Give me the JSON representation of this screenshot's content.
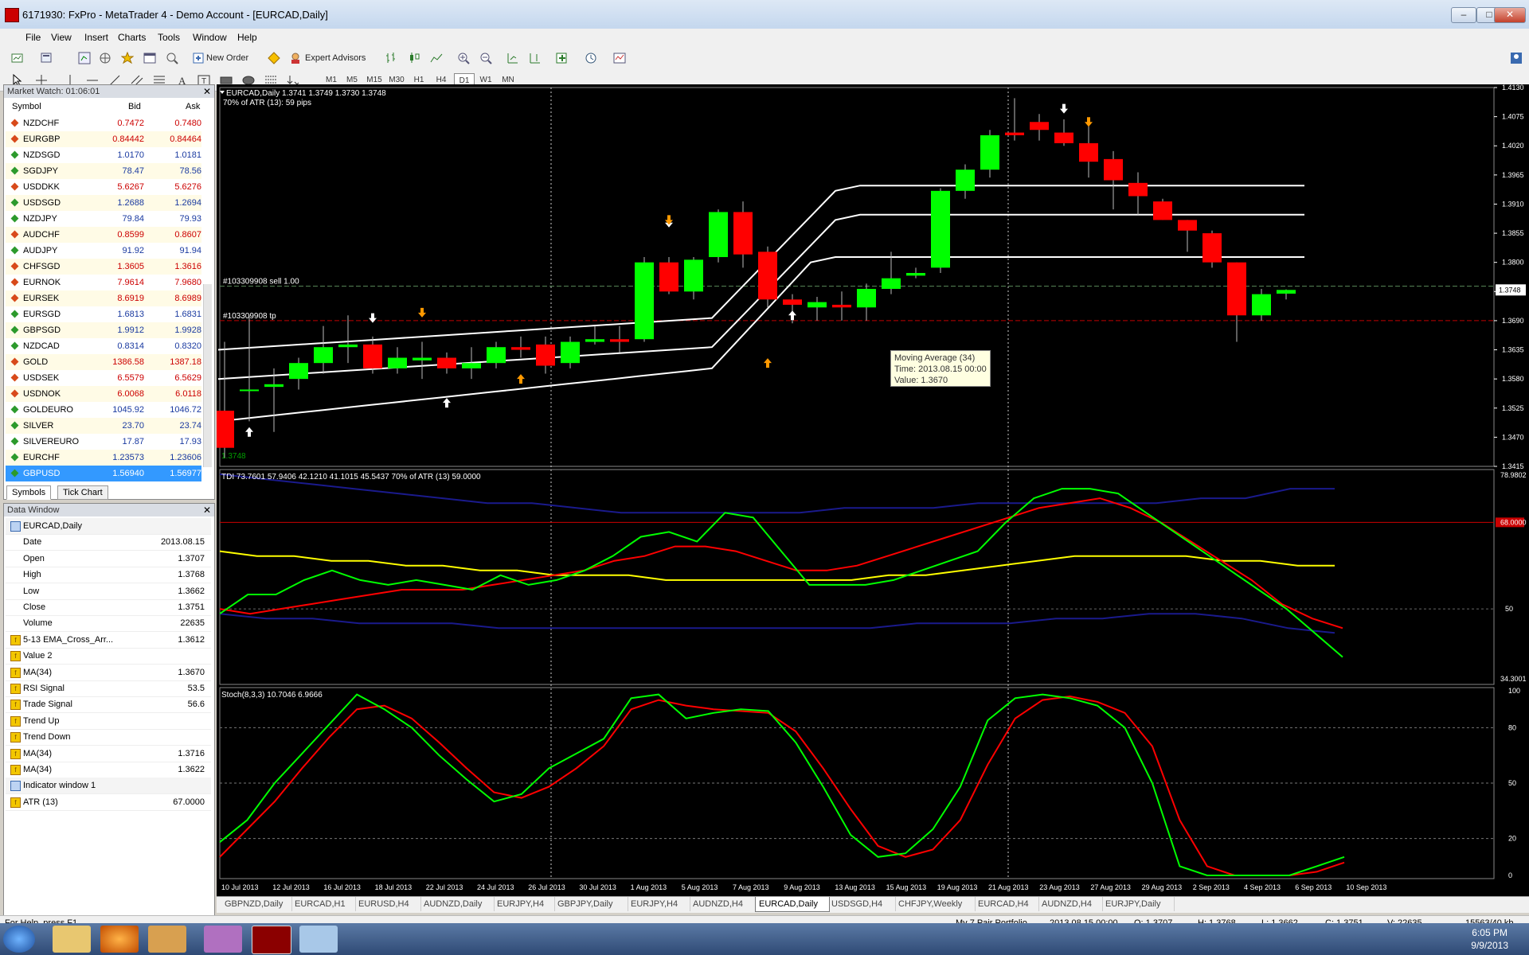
{
  "window": {
    "title": "6171930: FxPro - MetaTrader 4 - Demo Account - [EURCAD,Daily]",
    "minimize": "–",
    "restore": "□",
    "close": "✕"
  },
  "menu": [
    "File",
    "View",
    "Insert",
    "Charts",
    "Tools",
    "Window",
    "Help"
  ],
  "toolbar": {
    "new_order": "New Order",
    "expert_advisors": "Expert Advisors",
    "timeframes": [
      "M1",
      "M5",
      "M15",
      "M30",
      "H1",
      "H4",
      "D1",
      "W1",
      "MN"
    ],
    "active_timeframe": "D1"
  },
  "market_watch": {
    "title": "Market Watch: 01:06:01",
    "headers": {
      "symbol": "Symbol",
      "bid": "Bid",
      "ask": "Ask"
    },
    "rows": [
      {
        "symbol": "NZDCHF",
        "bid": "0.7472",
        "ask": "0.7480",
        "dir": "down"
      },
      {
        "symbol": "EURGBP",
        "bid": "0.84442",
        "ask": "0.84464",
        "dir": "down"
      },
      {
        "symbol": "NZDSGD",
        "bid": "1.0170",
        "ask": "1.0181",
        "dir": "up"
      },
      {
        "symbol": "SGDJPY",
        "bid": "78.47",
        "ask": "78.56",
        "dir": "up"
      },
      {
        "symbol": "USDDKK",
        "bid": "5.6267",
        "ask": "5.6276",
        "dir": "down"
      },
      {
        "symbol": "USDSGD",
        "bid": "1.2688",
        "ask": "1.2694",
        "dir": "up"
      },
      {
        "symbol": "NZDJPY",
        "bid": "79.84",
        "ask": "79.93",
        "dir": "up"
      },
      {
        "symbol": "AUDCHF",
        "bid": "0.8599",
        "ask": "0.8607",
        "dir": "down"
      },
      {
        "symbol": "AUDJPY",
        "bid": "91.92",
        "ask": "91.94",
        "dir": "up"
      },
      {
        "symbol": "CHFSGD",
        "bid": "1.3605",
        "ask": "1.3616",
        "dir": "down"
      },
      {
        "symbol": "EURNOK",
        "bid": "7.9614",
        "ask": "7.9680",
        "dir": "down"
      },
      {
        "symbol": "EURSEK",
        "bid": "8.6919",
        "ask": "8.6989",
        "dir": "down"
      },
      {
        "symbol": "EURSGD",
        "bid": "1.6813",
        "ask": "1.6831",
        "dir": "up"
      },
      {
        "symbol": "GBPSGD",
        "bid": "1.9912",
        "ask": "1.9928",
        "dir": "up"
      },
      {
        "symbol": "NZDCAD",
        "bid": "0.8314",
        "ask": "0.8320",
        "dir": "up"
      },
      {
        "symbol": "GOLD",
        "bid": "1386.58",
        "ask": "1387.18",
        "dir": "down"
      },
      {
        "symbol": "USDSEK",
        "bid": "6.5579",
        "ask": "6.5629",
        "dir": "down"
      },
      {
        "symbol": "USDNOK",
        "bid": "6.0068",
        "ask": "6.0118",
        "dir": "down"
      },
      {
        "symbol": "GOLDEURO",
        "bid": "1045.92",
        "ask": "1046.72",
        "dir": "up"
      },
      {
        "symbol": "SILVER",
        "bid": "23.70",
        "ask": "23.74",
        "dir": "up"
      },
      {
        "symbol": "SILVEREURO",
        "bid": "17.87",
        "ask": "17.93",
        "dir": "up"
      },
      {
        "symbol": "EURCHF",
        "bid": "1.23573",
        "ask": "1.23606",
        "dir": "up"
      },
      {
        "symbol": "GBPUSD",
        "bid": "1.56940",
        "ask": "1.56977",
        "dir": "up"
      }
    ],
    "tabs": [
      "Symbols",
      "Tick Chart"
    ]
  },
  "data_window": {
    "title": "Data Window",
    "rows": [
      {
        "label": "EURCAD,Daily",
        "value": "",
        "kind": "header"
      },
      {
        "label": "Date",
        "value": "2013.08.15",
        "kind": "plain"
      },
      {
        "label": "Open",
        "value": "1.3707",
        "kind": "plain"
      },
      {
        "label": "High",
        "value": "1.3768",
        "kind": "plain"
      },
      {
        "label": "Low",
        "value": "1.3662",
        "kind": "plain"
      },
      {
        "label": "Close",
        "value": "1.3751",
        "kind": "plain"
      },
      {
        "label": "Volume",
        "value": "22635",
        "kind": "plain"
      },
      {
        "label": "5-13 EMA_Cross_Arr...",
        "value": "1.3612",
        "kind": "ind"
      },
      {
        "label": "Value 2",
        "value": "",
        "kind": "ind"
      },
      {
        "label": "MA(34)",
        "value": "1.3670",
        "kind": "ind"
      },
      {
        "label": "RSI Signal",
        "value": "53.5",
        "kind": "ind"
      },
      {
        "label": "Trade Signal",
        "value": "56.6",
        "kind": "ind"
      },
      {
        "label": "Trend Up",
        "value": "",
        "kind": "ind"
      },
      {
        "label": "Trend Down",
        "value": "",
        "kind": "ind"
      },
      {
        "label": "MA(34)",
        "value": "1.3716",
        "kind": "ind"
      },
      {
        "label": "MA(34)",
        "value": "1.3622",
        "kind": "ind"
      },
      {
        "label": "Indicator window 1",
        "value": "",
        "kind": "header"
      },
      {
        "label": "ATR (13)",
        "value": "67.0000",
        "kind": "ind"
      }
    ]
  },
  "chart": {
    "header": "EURCAD,Daily  1.3741 1.3749 1.3730 1.3748",
    "atr_note": "70% of ATR (13): 59 pips",
    "sell_label": "#103309908 sell 1.00",
    "tp_label": "#103309908 tp",
    "big_price": "1.3748",
    "current_price": "1.3748",
    "price_axis": [
      "1.4130",
      "1.4075",
      "1.4020",
      "1.3965",
      "1.3910",
      "1.3855",
      "1.3800",
      "1.3745",
      "1.3690",
      "1.3635",
      "1.3580",
      "1.3525",
      "1.3470",
      "1.3415"
    ],
    "tdi_header": "TDI 73.7601 57.9406 42.1210 41.1015 45.5437  70% of ATR (13) 59.0000",
    "tdi_axis": {
      "top": "78.9802",
      "level": "68.0000",
      "mid": "50",
      "bottom": "34.3001"
    },
    "stoch_header": "Stoch(8,3,3) 10.7046 6.9666",
    "stoch_axis": [
      "100",
      "80",
      "50",
      "20",
      "0"
    ],
    "date_axis": [
      "10 Jul 2013",
      "12 Jul 2013",
      "16 Jul 2013",
      "18 Jul 2013",
      "22 Jul 2013",
      "24 Jul 2013",
      "26 Jul 2013",
      "30 Jul 2013",
      "1 Aug 2013",
      "5 Aug 2013",
      "7 Aug 2013",
      "9 Aug 2013",
      "13 Aug 2013",
      "15 Aug 2013",
      "19 Aug 2013",
      "21 Aug 2013",
      "23 Aug 2013",
      "27 Aug 2013",
      "29 Aug 2013",
      "2 Sep 2013",
      "4 Sep 2013",
      "6 Sep 2013",
      "10 Sep 2013"
    ]
  },
  "chart_data": {
    "type": "candlestick",
    "symbol": "EURCAD",
    "timeframe": "Daily",
    "ylim": [
      1.3415,
      1.413
    ],
    "candles": [
      {
        "o": 1.352,
        "h": 1.365,
        "l": 1.343,
        "c": 1.345
      },
      {
        "o": 1.356,
        "h": 1.37,
        "l": 1.35,
        "c": 1.356
      },
      {
        "o": 1.3565,
        "h": 1.36,
        "l": 1.348,
        "c": 1.357
      },
      {
        "o": 1.358,
        "h": 1.362,
        "l": 1.356,
        "c": 1.361
      },
      {
        "o": 1.361,
        "h": 1.368,
        "l": 1.359,
        "c": 1.364
      },
      {
        "o": 1.364,
        "h": 1.37,
        "l": 1.361,
        "c": 1.3645
      },
      {
        "o": 1.3645,
        "h": 1.366,
        "l": 1.359,
        "c": 1.36
      },
      {
        "o": 1.36,
        "h": 1.364,
        "l": 1.359,
        "c": 1.362
      },
      {
        "o": 1.3615,
        "h": 1.365,
        "l": 1.358,
        "c": 1.362
      },
      {
        "o": 1.362,
        "h": 1.363,
        "l": 1.359,
        "c": 1.36
      },
      {
        "o": 1.36,
        "h": 1.364,
        "l": 1.358,
        "c": 1.361
      },
      {
        "o": 1.361,
        "h": 1.365,
        "l": 1.36,
        "c": 1.364
      },
      {
        "o": 1.364,
        "h": 1.366,
        "l": 1.362,
        "c": 1.3635
      },
      {
        "o": 1.3645,
        "h": 1.366,
        "l": 1.359,
        "c": 1.3605
      },
      {
        "o": 1.361,
        "h": 1.366,
        "l": 1.36,
        "c": 1.365
      },
      {
        "o": 1.365,
        "h": 1.368,
        "l": 1.3645,
        "c": 1.3655
      },
      {
        "o": 1.3655,
        "h": 1.368,
        "l": 1.363,
        "c": 1.365
      },
      {
        "o": 1.3655,
        "h": 1.381,
        "l": 1.365,
        "c": 1.38
      },
      {
        "o": 1.38,
        "h": 1.381,
        "l": 1.374,
        "c": 1.3745
      },
      {
        "o": 1.3745,
        "h": 1.381,
        "l": 1.373,
        "c": 1.3805
      },
      {
        "o": 1.381,
        "h": 1.39,
        "l": 1.38,
        "c": 1.3895
      },
      {
        "o": 1.3895,
        "h": 1.3915,
        "l": 1.379,
        "c": 1.3815
      },
      {
        "o": 1.382,
        "h": 1.383,
        "l": 1.3715,
        "c": 1.373
      },
      {
        "o": 1.373,
        "h": 1.374,
        "l": 1.3685,
        "c": 1.372
      },
      {
        "o": 1.3715,
        "h": 1.3735,
        "l": 1.369,
        "c": 1.3725
      },
      {
        "o": 1.372,
        "h": 1.3745,
        "l": 1.369,
        "c": 1.3715
      },
      {
        "o": 1.3715,
        "h": 1.376,
        "l": 1.369,
        "c": 1.375
      },
      {
        "o": 1.375,
        "h": 1.382,
        "l": 1.374,
        "c": 1.377
      },
      {
        "o": 1.3775,
        "h": 1.379,
        "l": 1.377,
        "c": 1.378
      },
      {
        "o": 1.379,
        "h": 1.394,
        "l": 1.378,
        "c": 1.3935
      },
      {
        "o": 1.3935,
        "h": 1.3985,
        "l": 1.392,
        "c": 1.3975
      },
      {
        "o": 1.3975,
        "h": 1.405,
        "l": 1.396,
        "c": 1.404
      },
      {
        "o": 1.4045,
        "h": 1.411,
        "l": 1.403,
        "c": 1.404
      },
      {
        "o": 1.4065,
        "h": 1.408,
        "l": 1.403,
        "c": 1.405
      },
      {
        "o": 1.4045,
        "h": 1.407,
        "l": 1.402,
        "c": 1.4025
      },
      {
        "o": 1.4025,
        "h": 1.406,
        "l": 1.396,
        "c": 1.399
      },
      {
        "o": 1.3995,
        "h": 1.401,
        "l": 1.39,
        "c": 1.3955
      },
      {
        "o": 1.395,
        "h": 1.397,
        "l": 1.389,
        "c": 1.3925
      },
      {
        "o": 1.3915,
        "h": 1.392,
        "l": 1.388,
        "c": 1.388
      },
      {
        "o": 1.388,
        "h": 1.388,
        "l": 1.382,
        "c": 1.386
      },
      {
        "o": 1.3855,
        "h": 1.386,
        "l": 1.379,
        "c": 1.38
      },
      {
        "o": 1.38,
        "h": 1.38,
        "l": 1.365,
        "c": 1.37
      },
      {
        "o": 1.37,
        "h": 1.375,
        "l": 1.369,
        "c": 1.374
      },
      {
        "o": 1.3741,
        "h": 1.3749,
        "l": 1.373,
        "c": 1.3748
      }
    ],
    "tdi": {
      "ylim": [
        34.3001,
        78.9802
      ],
      "level": 68.0,
      "green": [
        49,
        53,
        53,
        56,
        58,
        56,
        55,
        56,
        55,
        54,
        57,
        55,
        56,
        58,
        61,
        65,
        66,
        64,
        70,
        69,
        62,
        55,
        55,
        55,
        56,
        58,
        60,
        62,
        68,
        73,
        75,
        75,
        74,
        70,
        66,
        62,
        58,
        54,
        50,
        45,
        40
      ],
      "red": [
        50,
        49,
        50,
        51,
        52,
        53,
        54,
        54,
        54,
        55,
        56,
        57,
        58,
        60,
        61,
        63,
        63,
        62,
        60,
        58,
        58,
        59,
        61,
        63,
        65,
        67,
        69,
        71,
        72,
        73,
        71,
        68,
        64,
        60,
        56,
        51,
        48,
        46
      ],
      "yellow": [
        62,
        61,
        61,
        60,
        60,
        59,
        59,
        58,
        58,
        57,
        57,
        57,
        56,
        56,
        56,
        56,
        56,
        56,
        57,
        57,
        58,
        59,
        60,
        61,
        61,
        61,
        61,
        60,
        60,
        59,
        59
      ],
      "blue_upper": [
        78,
        77,
        76,
        75,
        74,
        73,
        72,
        72,
        71,
        70,
        70,
        70,
        70,
        70,
        71,
        71,
        71,
        72,
        72,
        72,
        72,
        72,
        73,
        73,
        75,
        75
      ],
      "blue_lower": [
        49,
        48,
        48,
        47,
        47,
        47,
        46,
        46,
        46,
        46,
        46,
        46,
        46,
        46,
        46,
        47,
        47,
        47,
        48,
        48,
        49,
        49,
        48,
        46,
        45
      ]
    },
    "stoch": {
      "ylim": [
        0,
        100
      ],
      "main": [
        18,
        30,
        50,
        66,
        82,
        98,
        90,
        80,
        65,
        52,
        40,
        44,
        58,
        66,
        74,
        96,
        98,
        85,
        88,
        90,
        89,
        72,
        48,
        22,
        10,
        12,
        25,
        48,
        84,
        96,
        98,
        96,
        92,
        80,
        50,
        5,
        0,
        0,
        0,
        0,
        5,
        10
      ],
      "signal": [
        10,
        25,
        40,
        58,
        75,
        90,
        92,
        85,
        72,
        58,
        45,
        42,
        48,
        58,
        70,
        90,
        95,
        92,
        90,
        89,
        88,
        78,
        58,
        36,
        16,
        10,
        14,
        30,
        60,
        85,
        95,
        97,
        94,
        88,
        70,
        30,
        5,
        0,
        0,
        0,
        2,
        7
      ]
    }
  },
  "tooltip": {
    "line1": "Moving Average (34)",
    "line2": "Time: 2013.08.15 00:00",
    "line3": "Value: 1.3670"
  },
  "chart_tabs": [
    "GBPNZD,Daily",
    "EURCAD,H1",
    "EURUSD,H4",
    "AUDNZD,Daily",
    "EURJPY,H4",
    "GBPJPY,Daily",
    "EURJPY,H4",
    "AUDNZD,H4",
    "EURCAD,Daily",
    "USDSGD,H4",
    "CHFJPY,Weekly",
    "EURCAD,H4",
    "AUDNZD,H4",
    "EURJPY,Daily"
  ],
  "active_chart_tab": "EURCAD,Daily",
  "status": {
    "help": "For Help, press F1",
    "profile": "My 7 Pair Portfolio",
    "time": "2013.08.15 00:00",
    "open": "O: 1.3707",
    "high": "H: 1.3768",
    "low": "L: 1.3662",
    "close": "C: 1.3751",
    "volume": "V: 22635",
    "traffic": "15563/40 kb"
  },
  "taskbar": {
    "time": "6:05 PM",
    "date": "9/9/2013"
  },
  "colors": {
    "bull": "#00ff00",
    "bear": "#ff0000",
    "ma": "#ffffff",
    "tdi_green": "#00ff00",
    "tdi_red": "#ff0000",
    "tdi_yellow": "#ffff00",
    "tdi_blue": "#1a1a8c",
    "big_price": "#00a000",
    "ask": "#cc0000"
  }
}
